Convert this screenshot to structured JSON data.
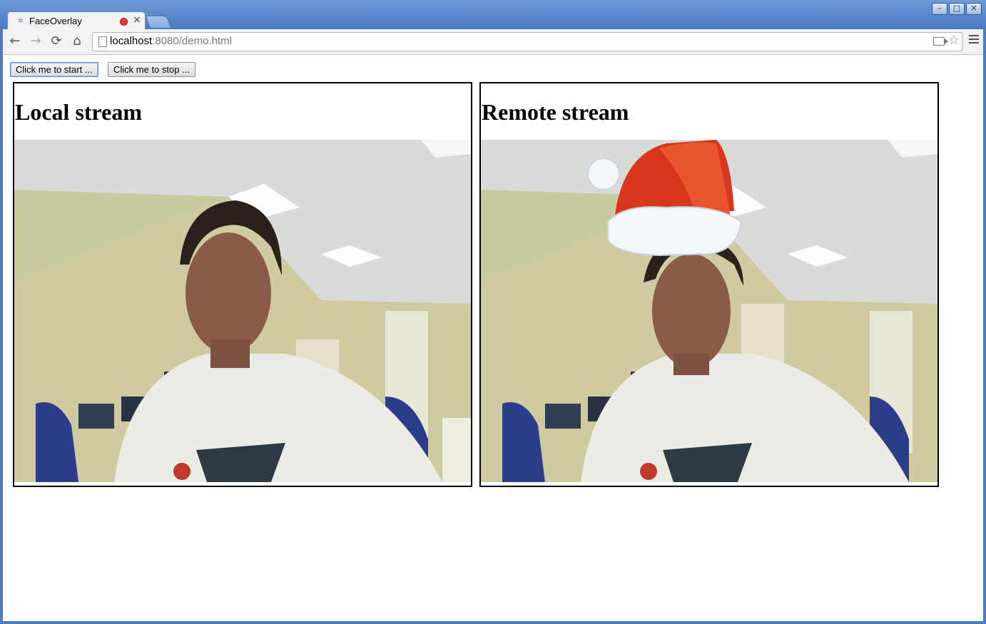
{
  "window": {
    "controls": [
      "–",
      "□",
      "✕"
    ]
  },
  "tab": {
    "title": "FaceOverlay",
    "close": "×"
  },
  "toolbar": {
    "back": "←",
    "forward": "→",
    "reload": "⟳",
    "home": "⌂",
    "url_host": "localhost",
    "url_rest": ":8080/demo.html",
    "star": "☆"
  },
  "page": {
    "start_button": "Click me to start ...",
    "stop_button": "Click me to stop ...",
    "local_title": "Local stream",
    "remote_title": "Remote stream"
  },
  "icons": {
    "favicon": "page-icon",
    "recording": "record-dot-icon",
    "camera": "camera-icon",
    "bookmark": "star-icon",
    "menu": "hamburger-icon"
  },
  "colors": {
    "chrome_frame": "#4c7bc4",
    "record_dot": "#e53935",
    "santa_hat": "#d9361c"
  }
}
